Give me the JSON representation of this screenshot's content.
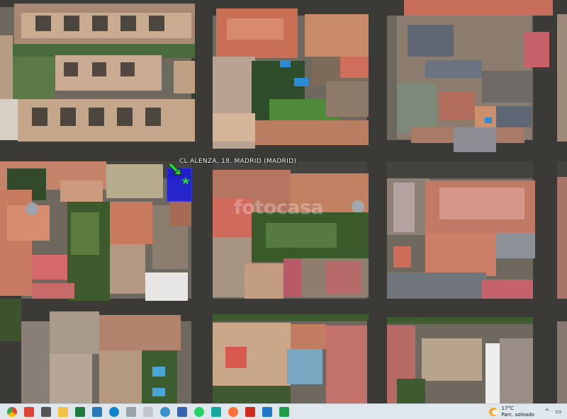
{
  "map": {
    "address_label": "CL ALENZA, 18. MADRID (MADRID)",
    "watermark": "fotocasa",
    "marker_color": "#1a1adf",
    "arrow_color": "#2ecc40"
  },
  "taskbar": {
    "apps": [
      {
        "name": "start",
        "icon": "windows-logo-icon",
        "color": "#1a73e8"
      },
      {
        "name": "chrome",
        "icon": "chrome-icon",
        "color": "#db4437"
      },
      {
        "name": "task-view",
        "icon": "task-view-icon",
        "color": "#555555"
      },
      {
        "name": "file-explorer",
        "icon": "folder-icon",
        "color": "#f3c243"
      },
      {
        "name": "excel",
        "icon": "excel-icon",
        "color": "#1f7a3f"
      },
      {
        "name": "photos",
        "icon": "photos-icon",
        "color": "#2a7ab8"
      },
      {
        "name": "edge",
        "icon": "edge-icon",
        "color": "#0f83c9"
      },
      {
        "name": "notepad",
        "icon": "document-icon",
        "color": "#9aa4ad"
      },
      {
        "name": "document",
        "icon": "file-icon",
        "color": "#c0c6cc"
      },
      {
        "name": "globe",
        "icon": "globe-icon",
        "color": "#3a8fd1"
      },
      {
        "name": "save",
        "icon": "floppy-icon",
        "color": "#3b63b0"
      },
      {
        "name": "whatsapp",
        "icon": "whatsapp-icon",
        "color": "#25d366"
      },
      {
        "name": "app-c",
        "icon": "swirl-icon",
        "color": "#18a6a0"
      },
      {
        "name": "firefox",
        "icon": "firefox-icon",
        "color": "#ff7139"
      },
      {
        "name": "acrobat",
        "icon": "acrobat-icon",
        "color": "#d12a1e"
      },
      {
        "name": "app-s",
        "icon": "s-app-icon",
        "color": "#2377c8"
      },
      {
        "name": "app-green",
        "icon": "green-app-icon",
        "color": "#1e9e48"
      }
    ],
    "weather": {
      "temperature": "17°C",
      "condition": "Parc. soleado"
    },
    "tray_chevron": "^",
    "tray_network": "▭"
  }
}
